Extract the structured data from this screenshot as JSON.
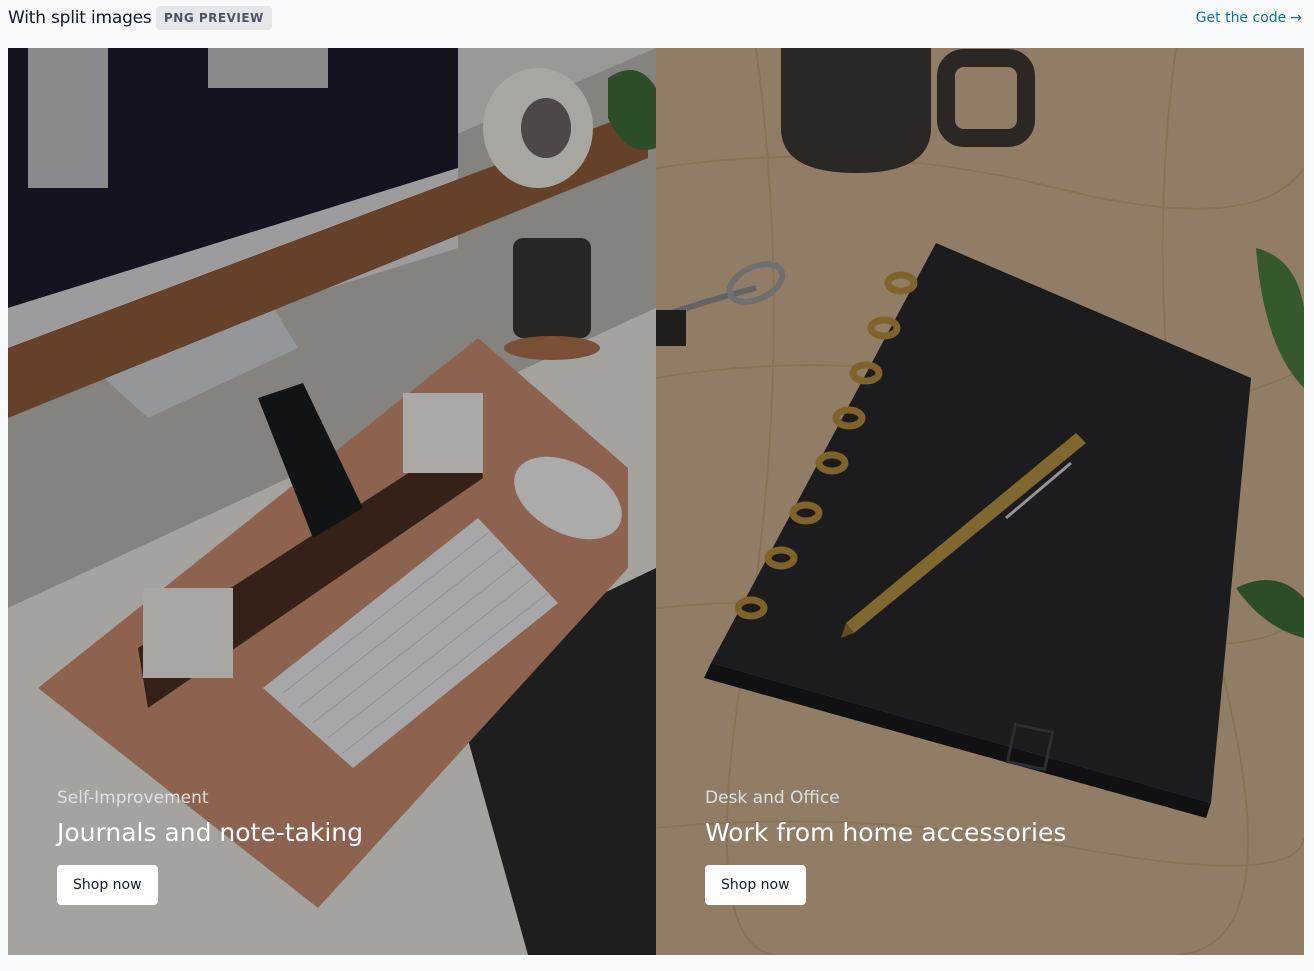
{
  "header": {
    "title": "With split images",
    "badge": "PNG PREVIEW",
    "code_link": "Get the code",
    "code_link_icon": "arrow-right-icon"
  },
  "panels": [
    {
      "eyebrow": "Self-Improvement",
      "headline": "Journals and note-taking",
      "button": "Shop now",
      "image": "desk setup with monitor, keyboard, mouse and organizer"
    },
    {
      "eyebrow": "Desk and Office",
      "headline": "Work from home accessories",
      "button": "Shop now",
      "image": "black notebook with brass pen on wooden desk"
    }
  ],
  "colors": {
    "link": "#0e7490",
    "badge_bg": "#e5e7eb",
    "button_bg": "#ffffff"
  }
}
